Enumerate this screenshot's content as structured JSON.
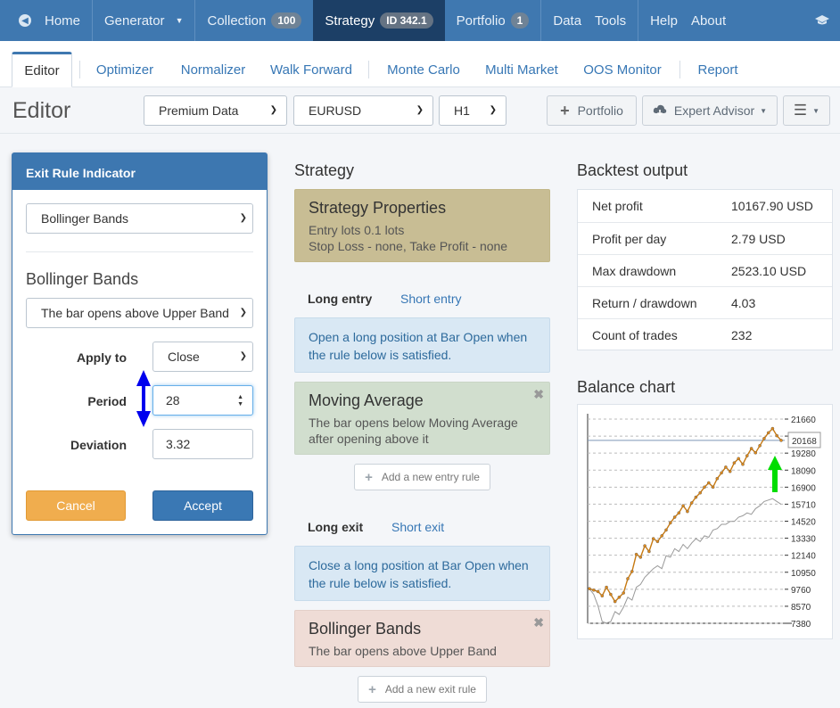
{
  "navbar": {
    "home": "Home",
    "generator": "Generator",
    "collection": "Collection",
    "collection_badge": "100",
    "strategy": "Strategy",
    "strategy_badge": "ID 342.1",
    "portfolio": "Portfolio",
    "portfolio_badge": "1",
    "data": "Data",
    "tools": "Tools",
    "help": "Help",
    "about": "About"
  },
  "tabs": [
    "Editor",
    "Optimizer",
    "Normalizer",
    "Walk Forward",
    "Monte Carlo",
    "Multi Market",
    "OOS Monitor",
    "Report"
  ],
  "toolbar": {
    "title": "Editor",
    "data_source": "Premium Data",
    "symbol": "EURUSD",
    "period": "H1",
    "portfolio_button": "Portfolio",
    "expert_advisor_button": "Expert Advisor"
  },
  "modal": {
    "header": "Exit Rule Indicator",
    "indicator": "Bollinger Bands",
    "indicator_title": "Bollinger Bands",
    "logic": "The bar opens above Upper Band",
    "apply_to_label": "Apply to",
    "apply_to": "Close",
    "period_label": "Period",
    "period": "28",
    "deviation_label": "Deviation",
    "deviation": "3.32",
    "cancel": "Cancel",
    "accept": "Accept"
  },
  "strategy": {
    "section_title": "Strategy",
    "properties_title": "Strategy Properties",
    "properties_line1": "Entry lots 0.1 lots",
    "properties_line2": "Stop Loss - none, Take Profit - none",
    "long_entry_tab": "Long entry",
    "short_entry_tab": "Short entry",
    "entry_info_line1": "Open a long position at Bar Open when",
    "entry_info_line2": "the rule below is satisfied.",
    "entry_rule_title": "Moving Average",
    "entry_rule_line1": "The bar opens below Moving Average",
    "entry_rule_line2": "after opening above it",
    "add_entry_rule": "Add a new entry rule",
    "long_exit_tab": "Long exit",
    "short_exit_tab": "Short exit",
    "exit_info_line1": "Close a long position at Bar Open when",
    "exit_info_line2": "the rule below is satisfied.",
    "exit_rule_title": "Bollinger Bands",
    "exit_rule_line1": "The bar opens above Upper Band",
    "add_exit_rule": "Add a new exit rule"
  },
  "backtest": {
    "title": "Backtest output",
    "rows": [
      {
        "label": "Net profit",
        "value": "10167.90 USD"
      },
      {
        "label": "Profit per day",
        "value": "2.79 USD"
      },
      {
        "label": "Max drawdown",
        "value": "2523.10 USD"
      },
      {
        "label": "Return / drawdown",
        "value": "4.03"
      },
      {
        "label": "Count of trades",
        "value": "232"
      }
    ]
  },
  "balance_chart": {
    "title": "Balance chart",
    "current_label": "20168"
  },
  "chart_data": {
    "type": "line",
    "y_ticks": [
      21660,
      20470,
      19280,
      18090,
      16900,
      15710,
      14520,
      13330,
      12140,
      10950,
      9760,
      8570,
      7380
    ],
    "ylim": [
      7380,
      21660
    ],
    "grid": true,
    "current_value": 20168,
    "series": [
      {
        "values": [
          9800,
          9700,
          9600,
          9300,
          9900,
          9400,
          8900,
          9200,
          9500,
          10500,
          11000,
          12200,
          12000,
          12800,
          12400,
          13300,
          13100,
          13500,
          13900,
          14400,
          14800,
          15100,
          15600,
          15200,
          15800,
          16200,
          16500,
          16900,
          17200,
          16900,
          17500,
          17900,
          18300,
          18000,
          18600,
          18900,
          18500,
          19100,
          19600,
          19300,
          19800,
          20300,
          20700,
          21000,
          20500,
          20168
        ]
      },
      {
        "values": [
          9800,
          9400,
          8600,
          7500,
          7400,
          7500,
          8200,
          8000,
          8500,
          9200,
          9000,
          9900,
          10100,
          10600,
          10900,
          11200,
          11400,
          11200,
          12100,
          12000,
          12600,
          12400,
          12900,
          12600,
          13000,
          13300,
          13100,
          13500,
          13400,
          13900,
          14000,
          14300,
          14300,
          14500,
          14500,
          14800,
          14900,
          15100,
          15000,
          15400,
          15600,
          15900,
          16000,
          16100,
          15900,
          15700
        ]
      }
    ]
  },
  "colors": {
    "navbar": "#3f78b0",
    "strategy_properties": "#c8bd94",
    "info_card": "#d9e8f4",
    "entry_rule_card": "#d1dece",
    "exit_rule_card": "#efdcd6",
    "cancel": "#f0ad4e",
    "accept": "#3a78b4",
    "annotation_blue_arrow": "#0000ee",
    "annotation_green_arrow": "#00dd00"
  }
}
